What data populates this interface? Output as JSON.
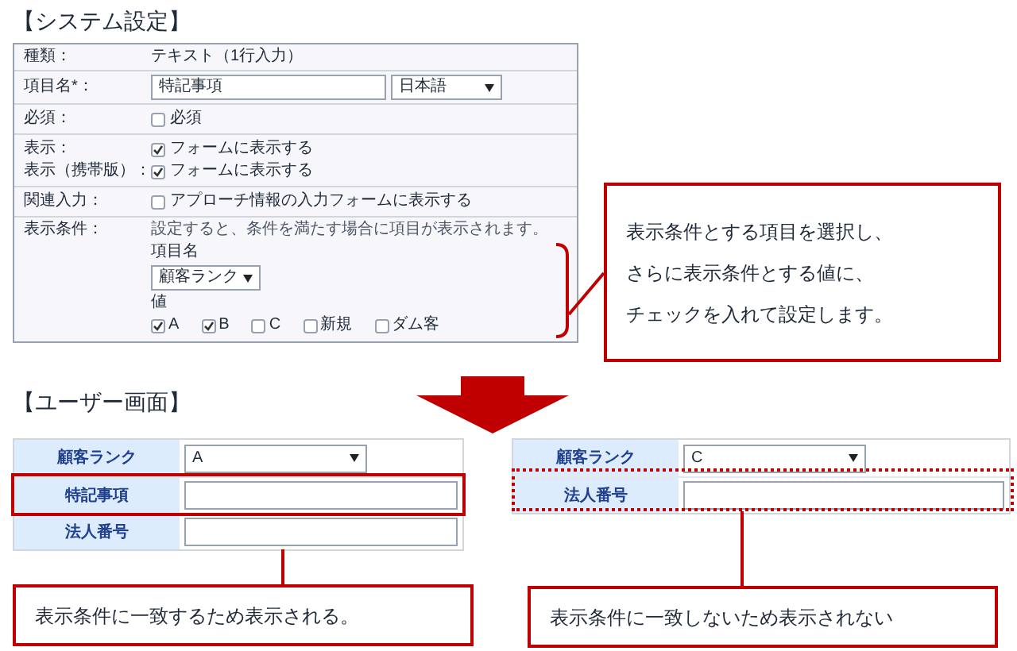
{
  "system_settings": {
    "title": "【システム設定】",
    "rows": [
      {
        "kind": "text",
        "label": "種類：",
        "value": "テキスト（1行入力）"
      },
      {
        "kind": "name",
        "label": "項目名*：",
        "value": "特記事項",
        "language": "日本語"
      },
      {
        "kind": "checks",
        "lines": [
          {
            "label": "必須：",
            "text": "必須",
            "checked": false
          }
        ]
      },
      {
        "kind": "checks",
        "lines": [
          {
            "label": "表示：",
            "text": "フォームに表示する",
            "checked": true
          },
          {
            "label": "表示（携帯版）：",
            "text": "フォームに表示する",
            "checked": true
          }
        ]
      },
      {
        "kind": "checks",
        "lines": [
          {
            "label": "関連入力：",
            "text": "アプローチ情報の入力フォームに表示する",
            "checked": false
          }
        ]
      },
      {
        "kind": "condition",
        "label": "表示条件：",
        "note": "設定すると、条件を満たす場合に項目が表示されます。",
        "field_label": "項目名",
        "field_value": "顧客ランク",
        "values_label": "値",
        "values": [
          {
            "label": "A",
            "checked": true
          },
          {
            "label": "B",
            "checked": true
          },
          {
            "label": "C",
            "checked": false
          },
          {
            "label": "新規",
            "checked": false
          },
          {
            "label": "ダム客",
            "checked": false
          }
        ]
      }
    ]
  },
  "settings_callout": {
    "lines": [
      "表示条件とする項目を選択し、",
      "さらに表示条件とする値に、",
      "チェックを入れて設定します。"
    ]
  },
  "user_screen": {
    "title": "【ユーザー画面】",
    "examples": [
      {
        "kind": "solid",
        "rows": [
          {
            "kind": "select",
            "label": "顧客ランク",
            "value": "A",
            "highlighted": false
          },
          {
            "kind": "input",
            "label": "特記事項",
            "highlighted": true
          },
          {
            "kind": "input",
            "label": "法人番号",
            "highlighted": false
          }
        ],
        "note": "表示条件に一致するため表示される。"
      },
      {
        "kind": "dotted",
        "rows": [
          {
            "kind": "select",
            "label": "顧客ランク",
            "value": "C"
          },
          {
            "kind": "input",
            "label": "法人番号"
          }
        ],
        "note": "表示条件に一致しないため表示されない"
      }
    ]
  }
}
